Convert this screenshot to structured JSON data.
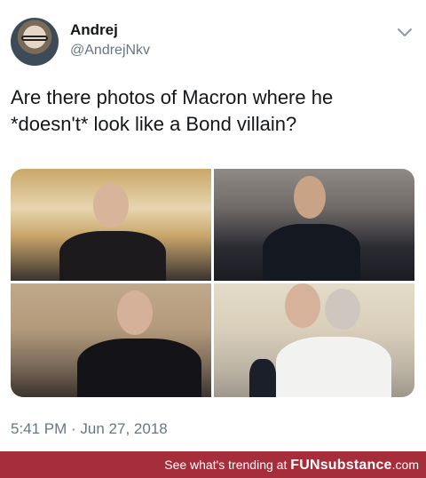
{
  "tweet": {
    "author": {
      "display_name": "Andrej",
      "handle": "@AndrejNkv"
    },
    "text": "Are there photos of Macron where he *doesn't* look like a Bond villain?",
    "media": [
      {
        "label": "photo-1"
      },
      {
        "label": "photo-2"
      },
      {
        "label": "photo-3"
      },
      {
        "label": "photo-4"
      }
    ],
    "timestamp": "5:41 PM · Jun 27, 2018",
    "menu_icon": "chevron-down-icon"
  },
  "banner": {
    "prefix": "See what's trending at ",
    "brand": "FUNsubstance",
    "suffix": ".com",
    "background_color": "#a62e3a"
  },
  "colors": {
    "text_primary": "#14171a",
    "text_secondary": "#657786"
  }
}
